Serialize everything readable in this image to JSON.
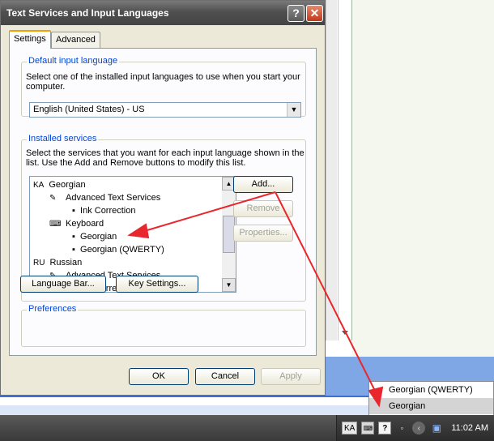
{
  "dialog": {
    "title": "Text Services and Input Languages",
    "help_glyph": "?",
    "close_glyph": "✕",
    "tabs": [
      {
        "label": "Settings"
      },
      {
        "label": "Advanced"
      }
    ],
    "default_group": {
      "label": "Default input language",
      "desc": "Select one of the installed input languages to use when you start your computer.",
      "selected": "English (United States) - US"
    },
    "services_group": {
      "label": "Installed services",
      "desc": "Select the services that you want for each input language shown in the list. Use the Add and Remove buttons to modify this list.",
      "tree": [
        {
          "badge": "KA",
          "text": "Georgian"
        },
        {
          "text": "Advanced Text Services"
        },
        {
          "text": "Ink Correction"
        },
        {
          "text": "Keyboard"
        },
        {
          "text": "Georgian"
        },
        {
          "text": "Georgian (QWERTY)"
        },
        {
          "badge": "RU",
          "text": "Russian"
        },
        {
          "text": "Advanced Text Services"
        },
        {
          "text": "Ink Correction"
        }
      ],
      "add": "Add...",
      "remove": "Remove",
      "properties": "Properties..."
    },
    "prefs_group": {
      "label": "Preferences",
      "language_bar": "Language Bar...",
      "key_settings": "Key Settings..."
    },
    "ok": "OK",
    "cancel": "Cancel",
    "apply": "Apply"
  },
  "lang_menu": {
    "items": [
      {
        "label": "Georgian (QWERTY)",
        "selected": false
      },
      {
        "label": "Georgian",
        "selected": true
      }
    ]
  },
  "taskbar": {
    "lang_indicator": "KA",
    "help_glyph": "?",
    "clock": "11:02 AM"
  },
  "colors": {
    "group_label": "#0046d5",
    "annotation_arrow": "#e8262d",
    "tab_highlight": "#f0a000"
  },
  "icons": [
    "help-icon",
    "close-icon",
    "keyboard-icon",
    "text-services-icon",
    "chevron-down-icon",
    "network-icon"
  ]
}
